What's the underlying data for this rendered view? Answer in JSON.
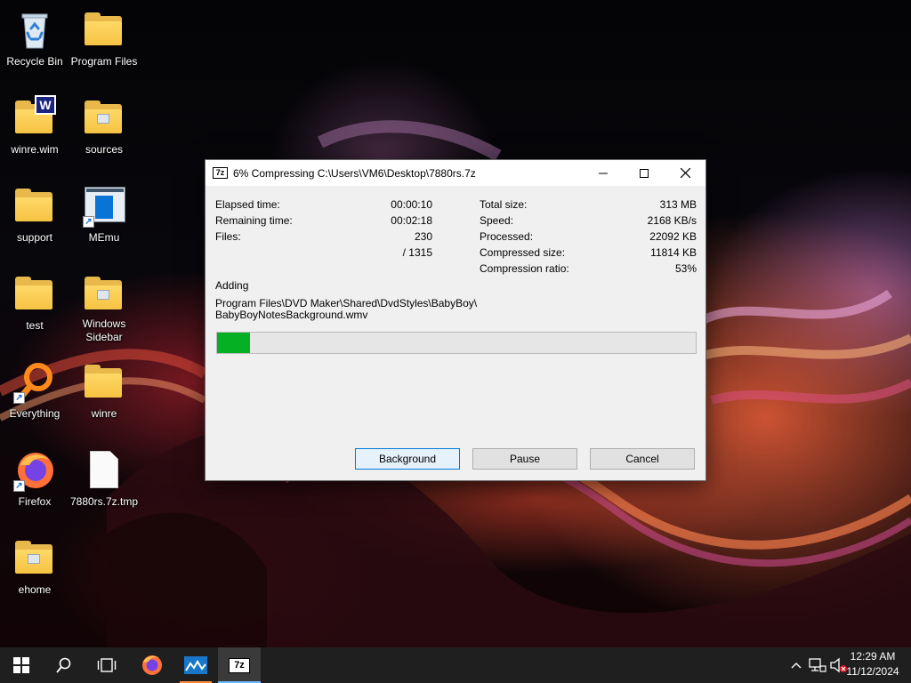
{
  "desktop": {
    "icons": [
      {
        "label": "Recycle Bin",
        "icon": "recycle-bin-icon"
      },
      {
        "label": "Program Files",
        "icon": "folder-icon"
      },
      {
        "label": "winre.wim",
        "icon": "wim-file-icon"
      },
      {
        "label": "sources",
        "icon": "folder-icon"
      },
      {
        "label": "support",
        "icon": "folder-icon"
      },
      {
        "label": "MEmu",
        "icon": "memu-shortcut-icon"
      },
      {
        "label": "test",
        "icon": "folder-icon"
      },
      {
        "label": "Windows Sidebar",
        "icon": "folder-icon"
      },
      {
        "label": "Everything",
        "icon": "everything-shortcut-icon"
      },
      {
        "label": "winre",
        "icon": "folder-icon"
      },
      {
        "label": "Firefox",
        "icon": "firefox-shortcut-icon"
      },
      {
        "label": "7880rs.7z.tmp",
        "icon": "blank-file-icon"
      },
      {
        "label": "ehome",
        "icon": "folder-icon"
      }
    ]
  },
  "dialog": {
    "app_icon_text": "7z",
    "title": "6% Compressing C:\\Users\\VM6\\Desktop\\7880rs.7z",
    "left_stats": [
      {
        "label": "Elapsed time:",
        "value": "00:00:10"
      },
      {
        "label": "Remaining time:",
        "value": "00:02:18"
      },
      {
        "label": "Files:",
        "value": "230"
      },
      {
        "label": "",
        "value": "/ 1315"
      }
    ],
    "right_stats": [
      {
        "label": "Total size:",
        "value": "313 MB"
      },
      {
        "label": "Speed:",
        "value": "2168 KB/s"
      },
      {
        "label": "Processed:",
        "value": "22092 KB"
      },
      {
        "label": "Compressed size:",
        "value": "11814 KB"
      },
      {
        "label": "Compression ratio:",
        "value": "53%"
      }
    ],
    "operation_label": "Adding",
    "current_path_line1": "Program Files\\DVD Maker\\Shared\\DvdStyles\\BabyBoy\\",
    "current_path_line2": "BabyBoyNotesBackground.wmv",
    "progress_percent": 6.8,
    "buttons": {
      "background": "Background",
      "pause": "Pause",
      "cancel": "Cancel"
    }
  },
  "taskbar": {
    "items": [
      "start-icon",
      "search-icon",
      "task-view-icon",
      "firefox-icon",
      "memu-icon",
      "7zip-icon"
    ],
    "active_item": "7zip-icon",
    "clock_time": "12:29 AM",
    "clock_date": "11/12/2024",
    "accent_color": "#0078d7"
  }
}
